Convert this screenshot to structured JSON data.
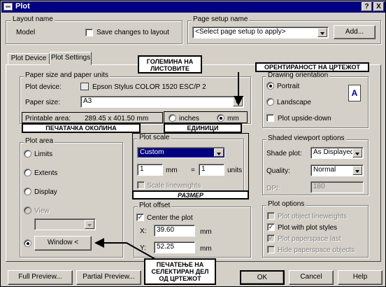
{
  "window": {
    "title": "Plot"
  },
  "titlebar_buttons": {
    "help": "?",
    "close": "X"
  },
  "layout": {
    "group_label": "Layout name",
    "name": "Model",
    "save_changes_label": "Save changes to layout",
    "save_changes_checked": false
  },
  "page_setup": {
    "group_label": "Page setup name",
    "select_value": "<Select page setup to apply>",
    "add_label": "Add..."
  },
  "tabs": [
    {
      "label": "Plot Device"
    },
    {
      "label": "Plot Settings"
    }
  ],
  "paper": {
    "group_label": "Paper size and paper units",
    "device_label": "Plot device:",
    "device_value": "Epson Stylus COLOR 1520 ESC/P 2",
    "size_label": "Paper size:",
    "size_value": "A3",
    "printable_label": "Printable area:",
    "printable_value": "289.45 x 401.50 mm",
    "units": [
      {
        "label": "inches",
        "selected": false
      },
      {
        "label": "mm",
        "selected": true
      }
    ]
  },
  "orientation": {
    "group_label": "Drawing orientation",
    "options": [
      {
        "label": "Portrait",
        "selected": true
      },
      {
        "label": "Landscape",
        "selected": false
      }
    ],
    "upside_down_label": "Plot upside-down",
    "upside_down_checked": false,
    "icon_letter": "A"
  },
  "plot_area": {
    "group_label": "Plot area",
    "options": [
      {
        "label": "Limits",
        "selected": false,
        "disabled": false
      },
      {
        "label": "Extents",
        "selected": false,
        "disabled": false
      },
      {
        "label": "Display",
        "selected": false,
        "disabled": false
      },
      {
        "label": "View",
        "selected": false,
        "disabled": true
      }
    ],
    "view_select_value": "",
    "window_button_label": "Window <"
  },
  "plot_scale": {
    "group_label": "Plot scale",
    "select_value": "Custom",
    "value1": "1",
    "unit1": "mm",
    "equals": "=",
    "value2": "1",
    "unit2": "units",
    "scale_lineweights_label": "Scale lineweights",
    "scale_lineweights_checked": false
  },
  "shaded": {
    "group_label": "Shaded viewport options",
    "shade_plot_label": "Shade plot:",
    "shade_plot_value": "As Displayed",
    "quality_label": "Quality:",
    "quality_value": "Normal",
    "dpi_label": "DPI:",
    "dpi_value": "180"
  },
  "plot_offset": {
    "group_label": "Plot offset",
    "center_label": "Center the plot",
    "center_checked": true,
    "x_label": "X:",
    "x_value": "39.60",
    "x_unit": "mm",
    "y_label": "Y:",
    "y_value": "52.25",
    "y_unit": "mm"
  },
  "plot_options": {
    "group_label": "Plot options",
    "items": [
      {
        "label": "Plot object lineweights",
        "checked": false,
        "disabled": true
      },
      {
        "label": "Plot with plot styles",
        "checked": true,
        "disabled": false
      },
      {
        "label": "Plot paperspace last",
        "checked": true,
        "disabled": true
      },
      {
        "label": "Hide paperspace objects",
        "checked": false,
        "disabled": true
      }
    ]
  },
  "buttons": {
    "full_preview": "Full Preview...",
    "partial_preview": "Partial Preview...",
    "ok": "OK",
    "cancel": "Cancel",
    "help": "Help"
  },
  "callouts": {
    "paper_size": "ГОЛЕМИНА НА\nЛИСТОВИТЕ",
    "orientation": "ОРЕНТИРАНОСТ НА ЦРТЕЖОТ",
    "printable": "ПЕЧАТАЧКА ОКОЛИНА",
    "units": "ЕДИНИЦИ",
    "scale": "РАЗМЕР",
    "window": "ПЕЧАТЕЊЕ НА\nСЕЛЕКТИРАН ДЕЛ\nОД ЦРТЕЖОТ"
  }
}
